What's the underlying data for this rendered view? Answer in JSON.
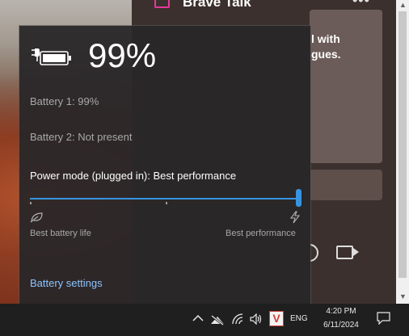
{
  "background_app": {
    "title": "Brave Talk",
    "menu_glyph": "•••",
    "card_text_line1": "l with",
    "card_text_line2": "gues.",
    "accent_color": "#e5389a"
  },
  "battery_flyout": {
    "percent_big": "99%",
    "battery1": "Battery 1: 99%",
    "battery2": "Battery 2: Not present",
    "power_mode_label": "Power mode (plugged in): Best performance",
    "slider_min_label": "Best battery life",
    "slider_max_label": "Best performance",
    "slider_value": 1.0,
    "settings_link": "Battery settings",
    "accent_color": "#3794e0",
    "icons": [
      "battery-charging-icon",
      "leaf-icon",
      "lightning-icon"
    ]
  },
  "taskbar": {
    "chevron": "^",
    "tray_icons": [
      "show-hidden-icons-chevron",
      "network-disconnected-icon",
      "wifi-icon",
      "volume-icon",
      "vivaldi-icon"
    ],
    "vivaldi_glyph": "V",
    "language": "ENG",
    "time": "4:20 PM",
    "date": "6/11/2024",
    "notification_icon": "notification-icon"
  }
}
